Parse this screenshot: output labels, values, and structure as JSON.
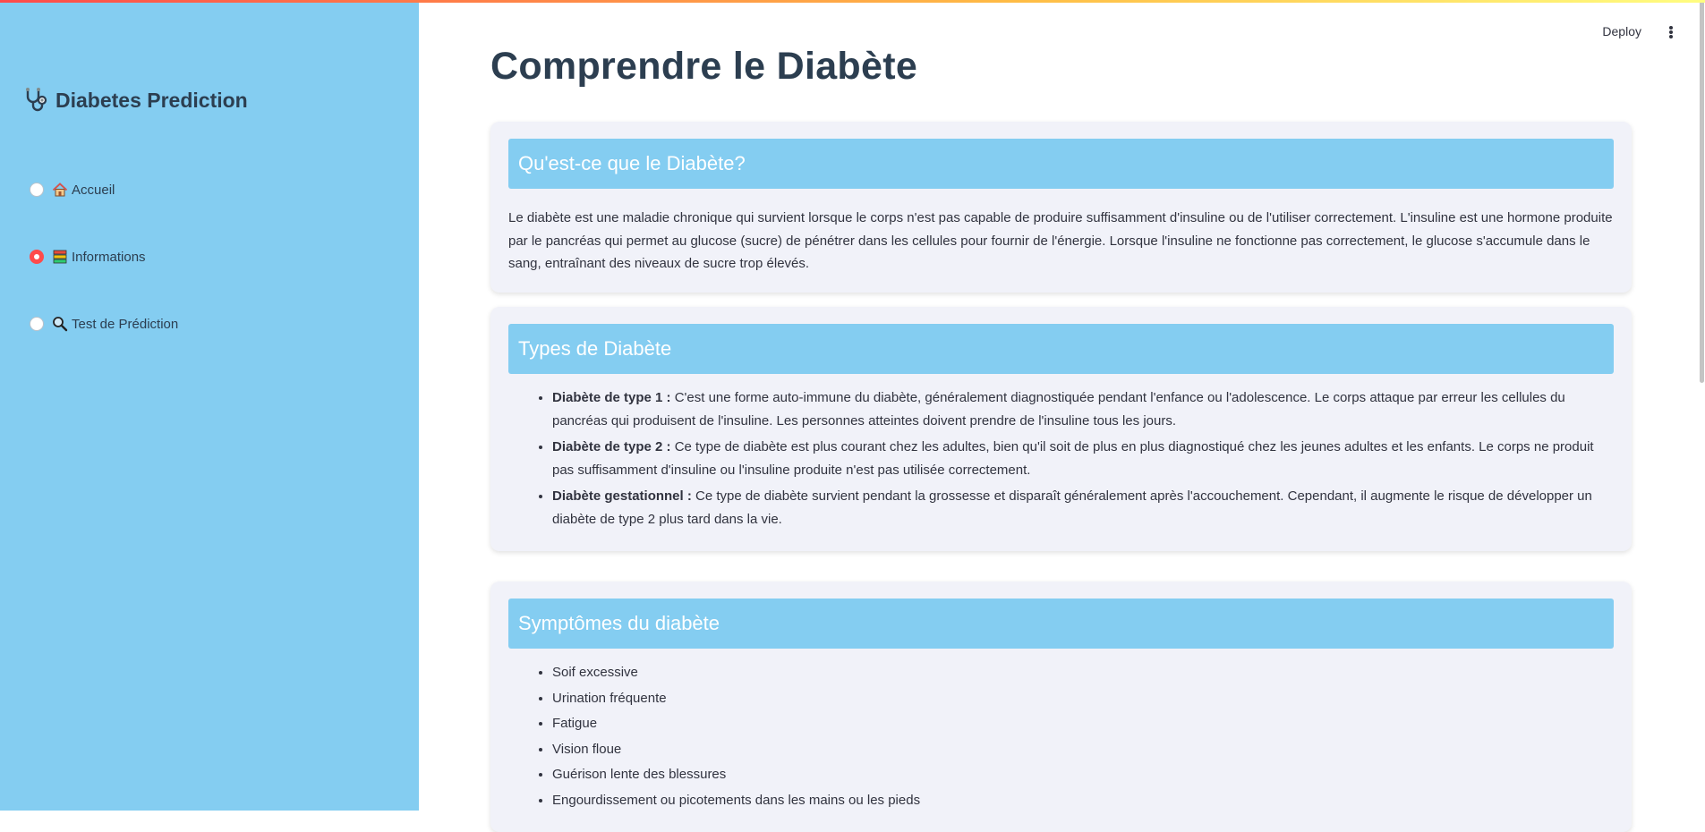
{
  "sidebar": {
    "title": "Diabetes Prediction",
    "nav": [
      {
        "label": "Accueil",
        "icon": "house-icon",
        "selected": false
      },
      {
        "label": "Informations",
        "icon": "books-icon",
        "selected": true
      },
      {
        "label": "Test de Prédiction",
        "icon": "magnifier-icon",
        "selected": false
      }
    ]
  },
  "header": {
    "deploy_label": "Deploy"
  },
  "main": {
    "title": "Comprendre le Diabète",
    "section1": {
      "heading": "Qu'est-ce que le Diabète?",
      "text": "Le diabète est une maladie chronique qui survient lorsque le corps n'est pas capable de produire suffisamment d'insuline ou de l'utiliser correctement. L'insuline est une hormone produite par le pancréas qui permet au glucose (sucre) de pénétrer dans les cellules pour fournir de l'énergie. Lorsque l'insuline ne fonctionne pas correctement, le glucose s'accumule dans le sang, entraînant des niveaux de sucre trop élevés."
    },
    "section2": {
      "heading": "Types de Diabète",
      "items": [
        {
          "term": "Diabète de type 1 :",
          "desc": " C'est une forme auto-immune du diabète, généralement diagnostiquée pendant l'enfance ou l'adolescence. Le corps attaque par erreur les cellules du pancréas qui produisent de l'insuline. Les personnes atteintes doivent prendre de l'insuline tous les jours."
        },
        {
          "term": "Diabète de type 2 :",
          "desc": " Ce type de diabète est plus courant chez les adultes, bien qu'il soit de plus en plus diagnostiqué chez les jeunes adultes et les enfants. Le corps ne produit pas suffisamment d'insuline ou l'insuline produite n'est pas utilisée correctement."
        },
        {
          "term": "Diabète gestationnel :",
          "desc": " Ce type de diabète survient pendant la grossesse et disparaît généralement après l'accouchement. Cependant, il augmente le risque de développer un diabète de type 2 plus tard dans la vie."
        }
      ]
    },
    "section3": {
      "heading": "Symptômes du diabète",
      "items": [
        "Soif excessive",
        "Urination fréquente",
        "Fatigue",
        "Vision floue",
        "Guérison lente des blessures",
        "Engourdissement ou picotements dans les mains ou les pieds"
      ]
    }
  },
  "colors": {
    "sidebar_bg": "#84cdf1",
    "card_header_bg": "#84cdf1",
    "card_bg": "#f1f2f9",
    "title_color": "#2c3e50",
    "radio_selected": "#ff4b4b"
  }
}
